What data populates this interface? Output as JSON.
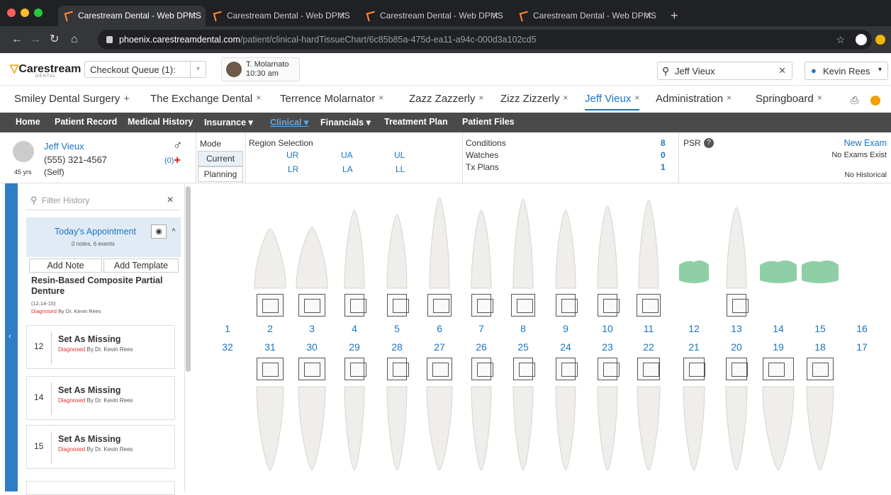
{
  "browser": {
    "tabs": [
      "Carestream Dental - Web DPMS",
      "Carestream Dental - Web DPMS",
      "Carestream Dental - Web DPMS",
      "Carestream Dental - Web DPMS"
    ],
    "url_host": "phoenix.carestreamdental.com",
    "url_path": "/patient/clinical-hardTissueChart/6c85b85a-475d-ea11-a94c-000d3a102cd5"
  },
  "app": {
    "logo": "Carestream",
    "logo_sub": "DENTAL",
    "queue_label": "Checkout Queue (1):",
    "appointment": {
      "name": "T. Molarnato",
      "time": "10:30 am"
    },
    "search_value": "Jeff Vieux",
    "user": "Kevin Rees"
  },
  "patient_tabs": [
    {
      "label": "Smiley Dental Surgery",
      "mark": "+"
    },
    {
      "label": "The Exchange Dental",
      "mark": "×"
    },
    {
      "label": "Terrence Molarnator",
      "mark": "×"
    },
    {
      "label": "Zazz Zazzerly",
      "mark": "×"
    },
    {
      "label": "Zizz Zizzerly",
      "mark": "×"
    },
    {
      "label": "Jeff Vieux",
      "mark": "×"
    },
    {
      "label": "Administration",
      "mark": "×"
    },
    {
      "label": "Springboard",
      "mark": "×"
    }
  ],
  "nav": [
    "Home",
    "Patient Record",
    "Medical History",
    "Insurance ▾",
    "Clinical ▾",
    "Financials ▾",
    "Treatment Plan",
    "Patient Files"
  ],
  "patient": {
    "name": "Jeff Vieux",
    "phone": "(555) 321-4567",
    "age": "45 yrs",
    "relation": "(Self)",
    "alert": "(0)",
    "gender_symbol": "♂"
  },
  "mode": {
    "label": "Mode",
    "current": "Current",
    "planning": "Planning"
  },
  "region": {
    "label": "Region Selection",
    "items": [
      "UR",
      "UA",
      "UL",
      "LR",
      "LA",
      "LL"
    ]
  },
  "counts": {
    "conditions_label": "Conditions",
    "conditions": "8",
    "watches_label": "Watches",
    "watches": "0",
    "txplans_label": "Tx Plans",
    "txplans": "1"
  },
  "psr": {
    "label": "PSR",
    "new_exam": "New Exam",
    "no_exams": "No Exams Exist",
    "no_historical": "No Historical"
  },
  "history": {
    "filter_placeholder": "Filter History",
    "appointment_title": "Today's Appointment",
    "appointment_sub": "0 notes, 6 events",
    "add_note": "Add Note",
    "add_template": "Add Template",
    "event1_title": "Resin-Based Composite Partial Denture",
    "event1_teeth": "(12,14-15)",
    "diagnosed": "Diagnosed",
    "by": "By Dr. Kevin Rees",
    "items": [
      {
        "num": "12",
        "title": "Set As Missing"
      },
      {
        "num": "14",
        "title": "Set As Missing"
      },
      {
        "num": "15",
        "title": "Set As Missing"
      }
    ]
  },
  "upper_numbers": [
    "1",
    "2",
    "3",
    "4",
    "5",
    "6",
    "7",
    "8",
    "9",
    "10",
    "11",
    "12",
    "13",
    "14",
    "15",
    "16"
  ],
  "lower_numbers": [
    "32",
    "31",
    "30",
    "29",
    "28",
    "27",
    "26",
    "25",
    "24",
    "23",
    "22",
    "21",
    "20",
    "19",
    "18",
    "17"
  ],
  "missing_teeth": [
    "12",
    "14",
    "15"
  ],
  "colors": {
    "accent": "#1a75c4",
    "nav": "#4a4a4a",
    "sidebar_strip": "#2f7dc5",
    "missing_tooth": "#8fcfa6",
    "diagnosed": "#e03030"
  }
}
